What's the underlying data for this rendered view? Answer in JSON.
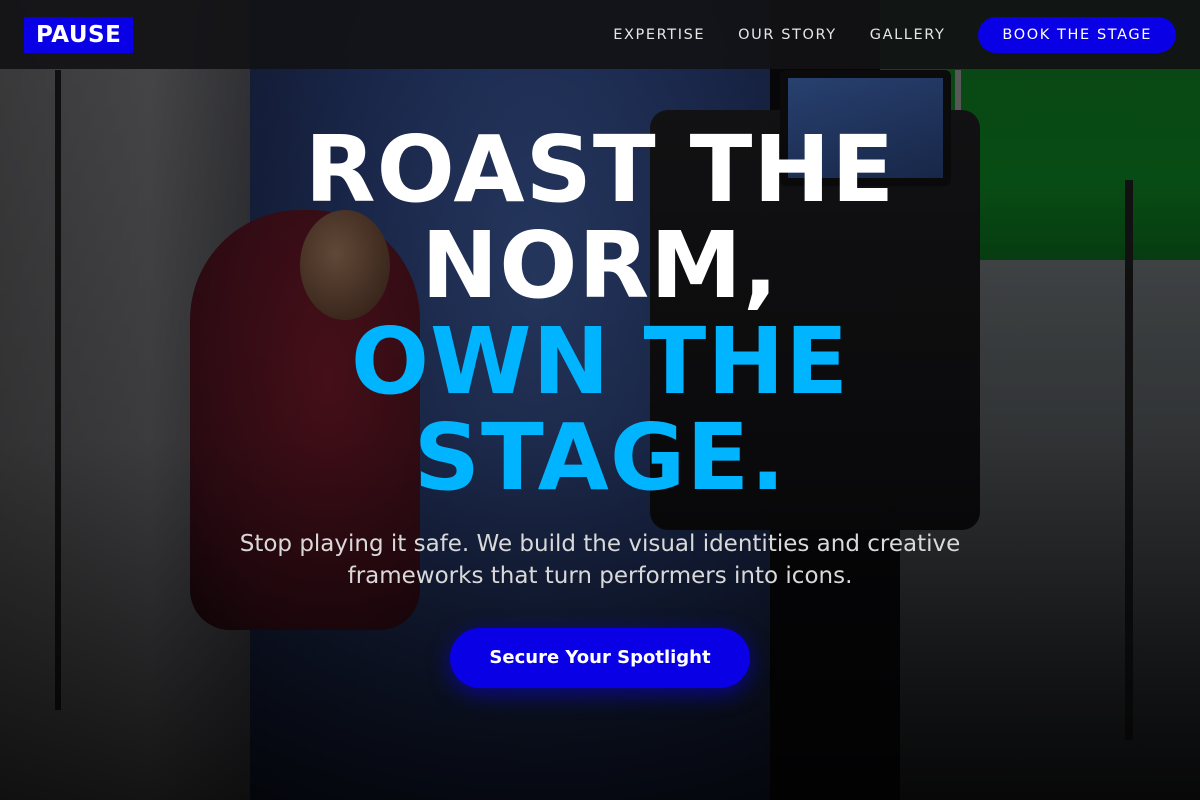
{
  "brand": {
    "logo_text": "PAUSE",
    "accent_color": "#0a00e6",
    "highlight_color": "#00b4ff"
  },
  "nav": {
    "links": [
      "EXPERTISE",
      "OUR STORY",
      "GALLERY"
    ],
    "cta_label": "BOOK THE STAGE"
  },
  "hero": {
    "headline_line1": "ROAST THE",
    "headline_line2": "NORM,",
    "headline_line3": "OWN THE",
    "headline_line4": "STAGE.",
    "subtitle": "Stop playing it safe. We build the visual identities and creative frameworks that turn performers into icons.",
    "cta_label": "Secure Your Spotlight"
  }
}
